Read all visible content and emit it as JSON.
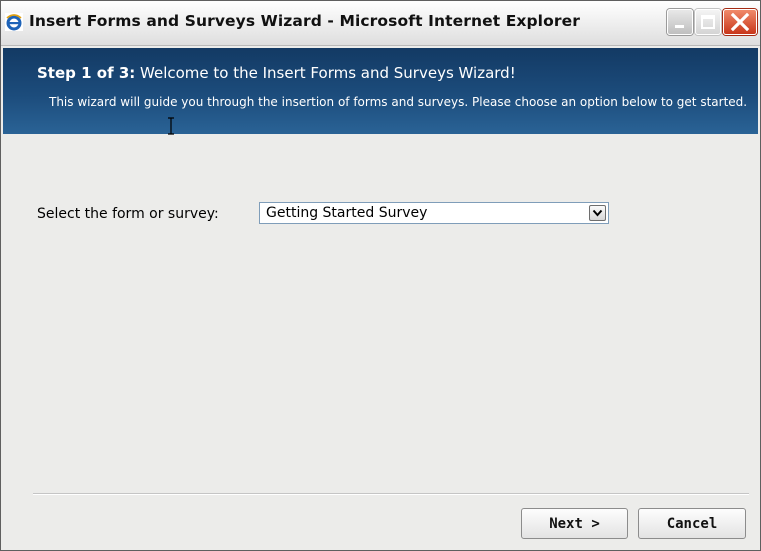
{
  "window": {
    "title": "Insert Forms and Surveys Wizard - Microsoft Internet Explorer",
    "app_icon": "internet-explorer-icon",
    "controls": {
      "minimize_icon": "minimize-icon",
      "maximize_icon": "maximize-icon",
      "close_icon": "close-icon"
    }
  },
  "header": {
    "step_prefix": "Step 1 of 3:",
    "step_title": " Welcome to the Insert Forms and Surveys Wizard!",
    "description": "This wizard will guide you through the insertion of forms and surveys. Please choose an option below to get started."
  },
  "form": {
    "select_label": "Select the form or survey:",
    "select_value": "Getting Started Survey",
    "dropdown_icon": "chevron-down-icon"
  },
  "buttons": {
    "next": "Next >",
    "cancel": "Cancel"
  },
  "colors": {
    "header_band": "#1c4c7c",
    "close_button": "#c8361a",
    "body_background": "#ececea"
  }
}
